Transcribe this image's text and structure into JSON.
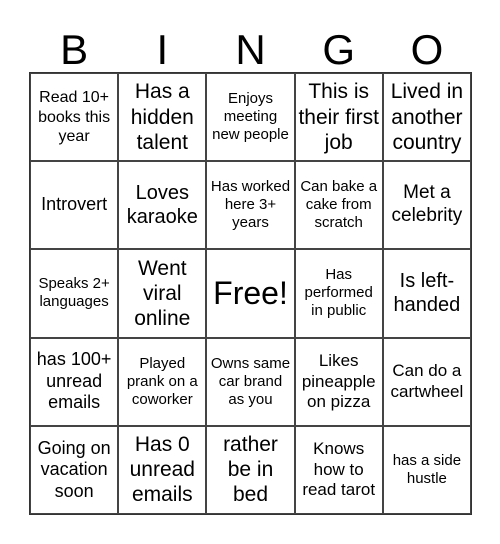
{
  "header": [
    "B",
    "I",
    "N",
    "G",
    "O"
  ],
  "cells": [
    "Read 10+ books this year",
    "Has a hidden talent",
    "Enjoys meeting new people",
    "This is their first job",
    "Lived in another country",
    "Introvert",
    "Loves karaoke",
    "Has worked here 3+ years",
    "Can bake a cake from scratch",
    "Met a celebrity",
    "Speaks 2+ languages",
    "Went viral online",
    "Free!",
    "Has performed in public",
    "Is left-handed",
    "has 100+ unread emails",
    "Played prank on a coworker",
    "Owns same car brand as you",
    "Likes pineapple on pizza",
    "Can do a cartwheel",
    "Going on vacation soon",
    "Has 0 unread emails",
    "rather be in bed",
    "Knows how to read tarot",
    "has a side hustle"
  ]
}
